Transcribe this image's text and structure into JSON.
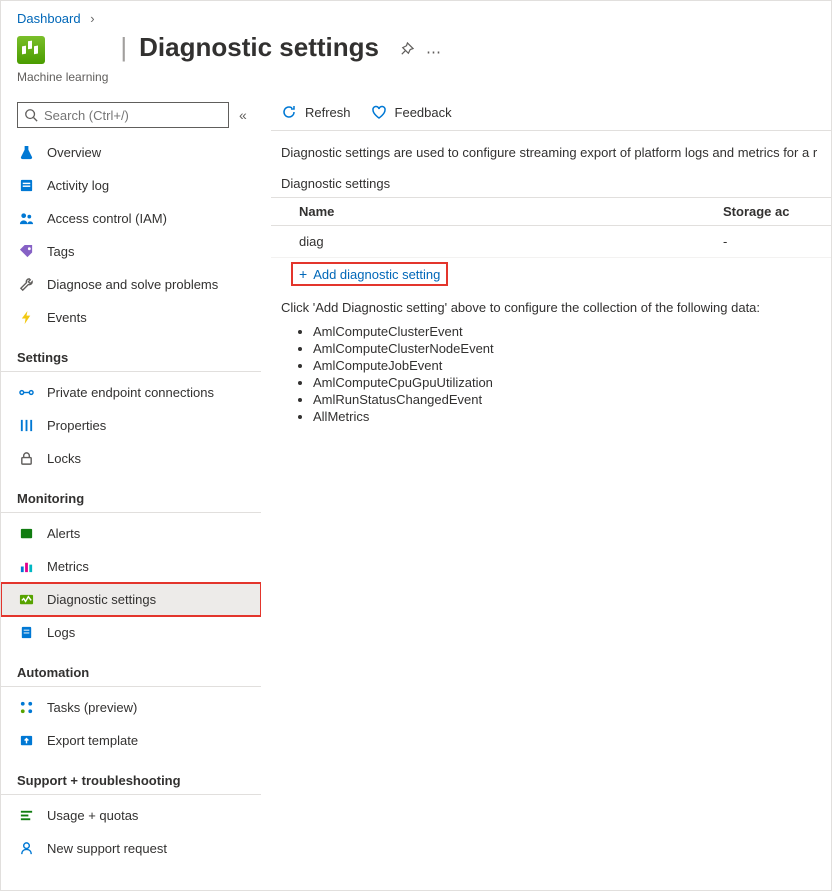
{
  "breadcrumb": {
    "dashboard": "Dashboard"
  },
  "resource": {
    "subtype": "Machine learning"
  },
  "page": {
    "title": "Diagnostic settings"
  },
  "search": {
    "placeholder": "Search (Ctrl+/)"
  },
  "nav": {
    "overview": "Overview",
    "activity": "Activity log",
    "iam": "Access control (IAM)",
    "tags": "Tags",
    "diagnose": "Diagnose and solve problems",
    "events": "Events",
    "g_settings": "Settings",
    "pec": "Private endpoint connections",
    "properties": "Properties",
    "locks": "Locks",
    "g_monitoring": "Monitoring",
    "alerts": "Alerts",
    "metrics": "Metrics",
    "diag": "Diagnostic settings",
    "logs": "Logs",
    "g_automation": "Automation",
    "tasks": "Tasks (preview)",
    "export": "Export template",
    "g_support": "Support + troubleshooting",
    "usage": "Usage + quotas",
    "supportreq": "New support request"
  },
  "toolbar": {
    "refresh": "Refresh",
    "feedback": "Feedback"
  },
  "content": {
    "description": "Diagnostic settings are used to configure streaming export of platform logs and metrics for a r",
    "section": "Diagnostic settings",
    "col_name": "Name",
    "col_storage": "Storage ac",
    "row1_name": "diag",
    "row1_storage": "-",
    "add": "Add diagnostic setting",
    "helper": "Click 'Add Diagnostic setting' above to configure the collection of the following data:",
    "types": {
      "0": "AmlComputeClusterEvent",
      "1": "AmlComputeClusterNodeEvent",
      "2": "AmlComputeJobEvent",
      "3": "AmlComputeCpuGpuUtilization",
      "4": "AmlRunStatusChangedEvent",
      "5": "AllMetrics"
    }
  }
}
